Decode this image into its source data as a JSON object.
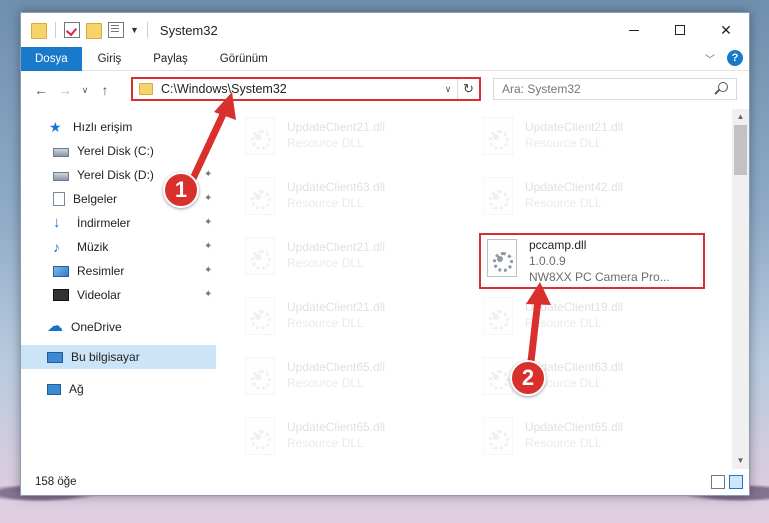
{
  "window": {
    "title": "System32",
    "min_label": "",
    "max_label": "",
    "close_label": "✕"
  },
  "ribbon": {
    "tabs": [
      "Dosya",
      "Giriş",
      "Paylaş",
      "Görünüm"
    ],
    "active_tab": "Dosya",
    "help_label": "?"
  },
  "nav": {
    "address": "C:\\Windows\\System32",
    "search_placeholder": "Ara: System32"
  },
  "sidebar": {
    "items": [
      {
        "label": "Hızlı erişim",
        "icon": "star-icon",
        "pinned": false
      },
      {
        "label": "Yerel Disk (C:)",
        "icon": "disk-icon",
        "pinned": false
      },
      {
        "label": "Yerel Disk (D:)",
        "icon": "disk-icon",
        "pinned": true
      },
      {
        "label": "Belgeler",
        "icon": "documents-icon",
        "pinned": true
      },
      {
        "label": "İndirmeler",
        "icon": "download-icon",
        "pinned": true
      },
      {
        "label": "Müzik",
        "icon": "music-icon",
        "pinned": true
      },
      {
        "label": "Resimler",
        "icon": "pictures-icon",
        "pinned": true
      },
      {
        "label": "Videolar",
        "icon": "videos-icon",
        "pinned": true
      },
      {
        "label": "OneDrive",
        "icon": "cloud-icon",
        "pinned": false
      },
      {
        "label": "Bu bilgisayar",
        "icon": "computer-icon",
        "pinned": false,
        "selected": true
      },
      {
        "label": "Ağ",
        "icon": "network-icon",
        "pinned": false
      }
    ]
  },
  "files": {
    "left": [
      {
        "name": "UpdateClient21.dll",
        "type": "Resource DLL"
      },
      {
        "name": "UpdateClient63.dll",
        "type": "Resource DLL"
      },
      {
        "name": "UpdateClient21.dll",
        "type": "Resource DLL"
      },
      {
        "name": "UpdateClient21.dll",
        "type": "Resource DLL"
      },
      {
        "name": "UpdateClient65.dll",
        "type": "Resource DLL"
      },
      {
        "name": "UpdateClient65.dll",
        "type": "Resource DLL"
      }
    ],
    "right": [
      {
        "name": "UpdateClient21.dll",
        "type": "Resource DLL"
      },
      {
        "name": "UpdateClient42.dll",
        "type": "Resource DLL"
      },
      {
        "name": "pccamp.dll",
        "version": "1.0.0.9",
        "type": "NW8XX PC Camera Pro..."
      },
      {
        "name": "UpdateClient19.dll",
        "type": "Resource DLL"
      },
      {
        "name": "UpdateClient63.dll",
        "type": "Resource DLL"
      },
      {
        "name": "UpdateClient65.dll",
        "type": "Resource DLL"
      }
    ]
  },
  "status": {
    "item_count": "158 öğe"
  },
  "annotations": {
    "badge1": "1",
    "badge2": "2",
    "color": "#d9302d"
  },
  "colors": {
    "accent": "#1979ca",
    "highlight": "#d9302d"
  }
}
